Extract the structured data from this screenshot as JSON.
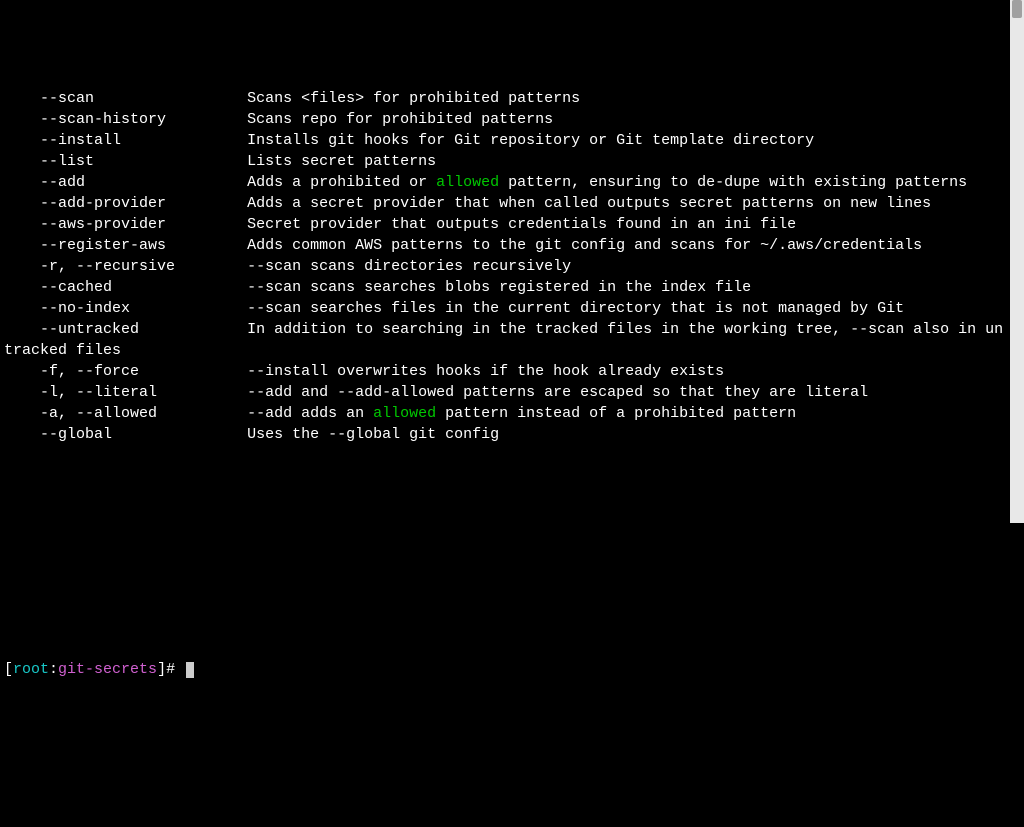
{
  "options": [
    {
      "flag": "    --scan",
      "desc": "Scans <files> for prohibited patterns"
    },
    {
      "flag": "    --scan-history",
      "desc": "Scans repo for prohibited patterns"
    },
    {
      "flag": "    --install",
      "desc": "Installs git hooks for Git repository or Git template directory"
    },
    {
      "flag": "    --list",
      "desc": "Lists secret patterns"
    },
    {
      "flag": "    --add",
      "desc_pre": "Adds a prohibited or ",
      "hl": "allowed",
      "desc_post": " pattern, ensuring to de-dupe with existing patterns"
    },
    {
      "flag": "    --add-provider",
      "desc": "Adds a secret provider that when called outputs secret patterns on new lines"
    },
    {
      "flag": "    --aws-provider",
      "desc": "Secret provider that outputs credentials found in an ini file"
    },
    {
      "flag": "    --register-aws",
      "desc": "Adds common AWS patterns to the git config and scans for ~/.aws/credentials"
    },
    {
      "flag": "    -r, --recursive",
      "desc": "--scan scans directories recursively"
    },
    {
      "flag": "    --cached",
      "desc": "--scan scans searches blobs registered in the index file"
    },
    {
      "flag": "    --no-index",
      "desc": "--scan searches files in the current directory that is not managed by Git"
    },
    {
      "flag": "    --untracked",
      "desc": "In addition to searching in the tracked files in the working tree, --scan also in untracked files"
    },
    {
      "flag": "    -f, --force",
      "desc": "--install overwrites hooks if the hook already exists"
    },
    {
      "flag": "    -l, --literal",
      "desc": "--add and --add-allowed patterns are escaped so that they are literal"
    },
    {
      "flag": "    -a, --allowed",
      "desc_pre": "--add adds an ",
      "hl": "allowed",
      "desc_post": " pattern instead of a prohibited pattern"
    },
    {
      "flag": "    --global",
      "desc": "Uses the --global git config"
    }
  ],
  "prompt": {
    "lb": "[",
    "user": "root",
    "sep": ":",
    "dir": "git-secrets",
    "rb": "]",
    "end": "# "
  },
  "flag_col_width": 27
}
